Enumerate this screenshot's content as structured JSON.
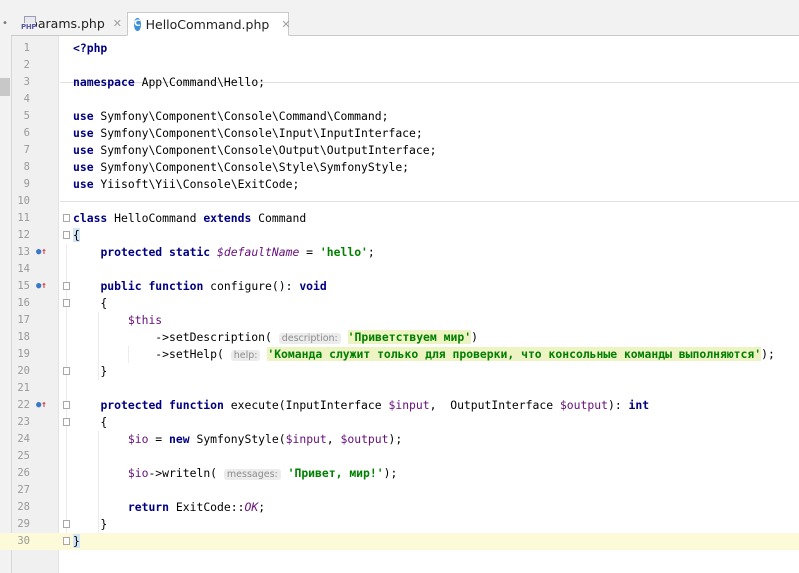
{
  "tabs": [
    {
      "label": "params.php",
      "icon": "php-file-icon",
      "icon_label": "PHP",
      "active": false
    },
    {
      "label": "HelloCommand.php",
      "icon": "php-class-icon",
      "icon_label": "C",
      "active": true
    }
  ],
  "close_glyph": "✕",
  "editor": {
    "current_line": 30,
    "lines": [
      {
        "n": "1",
        "tokens": [
          [
            "kw",
            "<?php"
          ]
        ]
      },
      {
        "n": "2",
        "tokens": []
      },
      {
        "n": "3",
        "tokens": [
          [
            "kw",
            "namespace"
          ],
          [
            "t",
            " App\\Command\\Hello;"
          ]
        ]
      },
      {
        "n": "4",
        "tokens": []
      },
      {
        "n": "5",
        "tokens": [
          [
            "kw",
            "use"
          ],
          [
            "t",
            " Symfony\\Component\\Console\\Command\\Command;"
          ]
        ]
      },
      {
        "n": "6",
        "tokens": [
          [
            "kw",
            "use"
          ],
          [
            "t",
            " Symfony\\Component\\Console\\Input\\InputInterface;"
          ]
        ]
      },
      {
        "n": "7",
        "tokens": [
          [
            "kw",
            "use"
          ],
          [
            "t",
            " Symfony\\Component\\Console\\Output\\OutputInterface;"
          ]
        ]
      },
      {
        "n": "8",
        "tokens": [
          [
            "kw",
            "use"
          ],
          [
            "t",
            " Symfony\\Component\\Console\\Style\\SymfonyStyle;"
          ]
        ]
      },
      {
        "n": "9",
        "tokens": [
          [
            "kw",
            "use"
          ],
          [
            "t",
            " Yiisoft\\Yii\\Console\\ExitCode;"
          ]
        ]
      },
      {
        "n": "10",
        "tokens": []
      },
      {
        "n": "11",
        "tokens": [
          [
            "kw",
            "class"
          ],
          [
            "t",
            " HelloCommand "
          ],
          [
            "kw",
            "extends"
          ],
          [
            "t",
            " Command"
          ]
        ]
      },
      {
        "n": "12",
        "tokens": [
          [
            "brace",
            "{"
          ]
        ]
      },
      {
        "n": "13",
        "tokens": [
          [
            "t",
            "    "
          ],
          [
            "kw",
            "protected static"
          ],
          [
            "t",
            " "
          ],
          [
            "varit",
            "$defaultName"
          ],
          [
            "t",
            " = "
          ],
          [
            "str",
            "'hello'"
          ],
          [
            "t",
            ";"
          ]
        ]
      },
      {
        "n": "14",
        "tokens": []
      },
      {
        "n": "15",
        "tokens": [
          [
            "t",
            "    "
          ],
          [
            "kw",
            "public function"
          ],
          [
            "t",
            " configure(): "
          ],
          [
            "kw",
            "void"
          ]
        ]
      },
      {
        "n": "16",
        "tokens": [
          [
            "t",
            "    {"
          ]
        ]
      },
      {
        "n": "17",
        "tokens": [
          [
            "t",
            "        "
          ],
          [
            "var",
            "$this"
          ]
        ]
      },
      {
        "n": "18",
        "tokens": [
          [
            "t",
            "            ->setDescription( "
          ],
          [
            "hint",
            "description:"
          ],
          [
            "t",
            " "
          ],
          [
            "strbg",
            "'Приветствуем мир'"
          ],
          [
            "t",
            ")"
          ]
        ]
      },
      {
        "n": "19",
        "tokens": [
          [
            "t",
            "            ->setHelp( "
          ],
          [
            "hint",
            "help:"
          ],
          [
            "t",
            " "
          ],
          [
            "strbg",
            "'Команда служит только для проверки, что консольные команды выполняются'"
          ],
          [
            "t",
            ");"
          ]
        ]
      },
      {
        "n": "20",
        "tokens": [
          [
            "t",
            "    }"
          ]
        ]
      },
      {
        "n": "21",
        "tokens": []
      },
      {
        "n": "22",
        "tokens": [
          [
            "t",
            "    "
          ],
          [
            "kw",
            "protected function"
          ],
          [
            "t",
            " execute(InputInterface "
          ],
          [
            "var",
            "$input"
          ],
          [
            "t",
            ",  OutputInterface "
          ],
          [
            "var",
            "$output"
          ],
          [
            "t",
            "): "
          ],
          [
            "kw",
            "int"
          ]
        ]
      },
      {
        "n": "23",
        "tokens": [
          [
            "t",
            "    {"
          ]
        ]
      },
      {
        "n": "24",
        "tokens": [
          [
            "t",
            "        "
          ],
          [
            "var",
            "$io"
          ],
          [
            "t",
            " = "
          ],
          [
            "kw",
            "new"
          ],
          [
            "t",
            " SymfonyStyle("
          ],
          [
            "var",
            "$input"
          ],
          [
            "t",
            ", "
          ],
          [
            "var",
            "$output"
          ],
          [
            "t",
            ");"
          ]
        ]
      },
      {
        "n": "25",
        "tokens": []
      },
      {
        "n": "26",
        "tokens": [
          [
            "t",
            "        "
          ],
          [
            "var",
            "$io"
          ],
          [
            "t",
            "->writeln( "
          ],
          [
            "hint",
            "messages:"
          ],
          [
            "t",
            " "
          ],
          [
            "str",
            "'Привет, мир!'"
          ],
          [
            "t",
            ");"
          ]
        ]
      },
      {
        "n": "27",
        "tokens": []
      },
      {
        "n": "28",
        "tokens": [
          [
            "t",
            "        "
          ],
          [
            "kw",
            "return"
          ],
          [
            "t",
            " ExitCode::"
          ],
          [
            "const",
            "OK"
          ],
          [
            "t",
            ";"
          ]
        ]
      },
      {
        "n": "29",
        "tokens": [
          [
            "t",
            "    }"
          ]
        ]
      },
      {
        "n": "30",
        "tokens": [
          [
            "brace",
            "}"
          ]
        ]
      }
    ],
    "override_markers": [
      13,
      15,
      22
    ],
    "fold_markers": [
      11,
      12,
      15,
      16,
      20,
      22,
      23,
      29,
      30
    ]
  }
}
